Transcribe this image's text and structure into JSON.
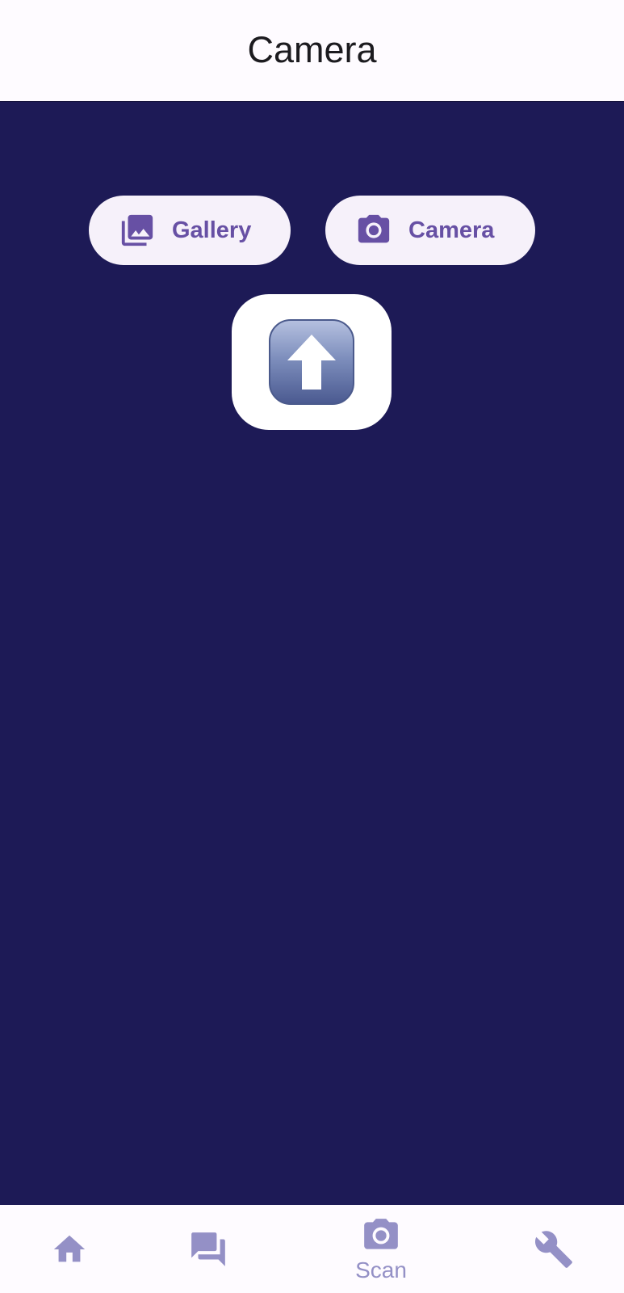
{
  "app_bar": {
    "title": "Camera"
  },
  "actions": {
    "gallery": {
      "label": "Gallery",
      "icon": "photo-library-icon"
    },
    "camera": {
      "label": "Camera",
      "icon": "camera-icon"
    }
  },
  "upload": {
    "icon": "up-arrow-button-icon"
  },
  "bottom_nav": {
    "items": [
      {
        "id": "home",
        "icon": "home-icon",
        "label": ""
      },
      {
        "id": "chat",
        "icon": "forum-icon",
        "label": ""
      },
      {
        "id": "scan",
        "icon": "camera-icon",
        "label": "Scan"
      },
      {
        "id": "tools",
        "icon": "wrench-icon",
        "label": ""
      }
    ]
  },
  "colors": {
    "background": "#1d1a56",
    "surface": "#fefbff",
    "button_bg": "#f6f1fa",
    "accent": "#6750a4",
    "nav_icon": "#9490c6"
  }
}
